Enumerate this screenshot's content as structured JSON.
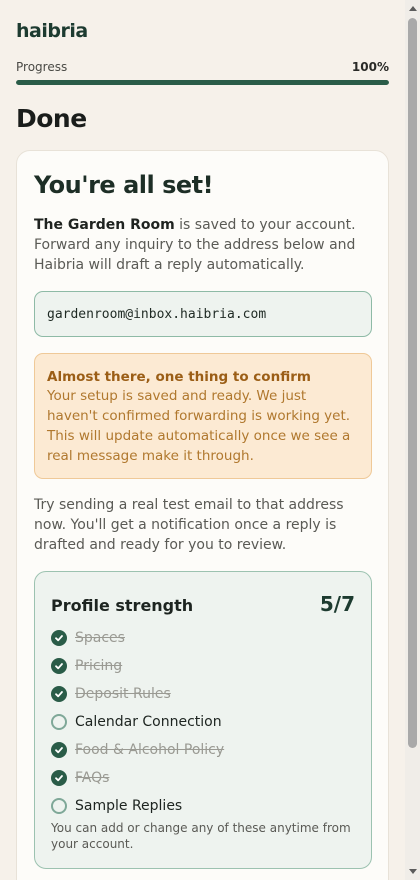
{
  "brand": {
    "logo": "haibria",
    "accent": "#2a5c48"
  },
  "progress": {
    "label": "Progress",
    "percent_text": "100%",
    "value": 1.0
  },
  "page_title": "Done",
  "card": {
    "title": "You're all set!",
    "intro_bold": "The Garden Room",
    "intro_rest": " is saved to your account. Forward any inquiry to the address below and Haibria will draft a reply automatically.",
    "email": "gardenroom@inbox.haibria.com",
    "warning": {
      "title": "Almost there, one thing to confirm",
      "body": "Your setup is saved and ready. We just haven't confirmed forwarding is working yet. This will update automatically once we see a real message make it through."
    },
    "note": "Try sending a real test email to that address now. You'll get a notification once a reply is drafted and ready for you to review.",
    "profile": {
      "title": "Profile strength",
      "score": "5/7",
      "items": [
        {
          "label": "Spaces",
          "done": true
        },
        {
          "label": "Pricing",
          "done": true
        },
        {
          "label": "Deposit Rules",
          "done": true
        },
        {
          "label": "Calendar Connection",
          "done": false
        },
        {
          "label": "Food & Alcohol Policy",
          "done": true
        },
        {
          "label": "FAQs",
          "done": true
        },
        {
          "label": "Sample Replies",
          "done": false
        }
      ],
      "footer": "You can add or change any of these anytime from your account."
    }
  }
}
